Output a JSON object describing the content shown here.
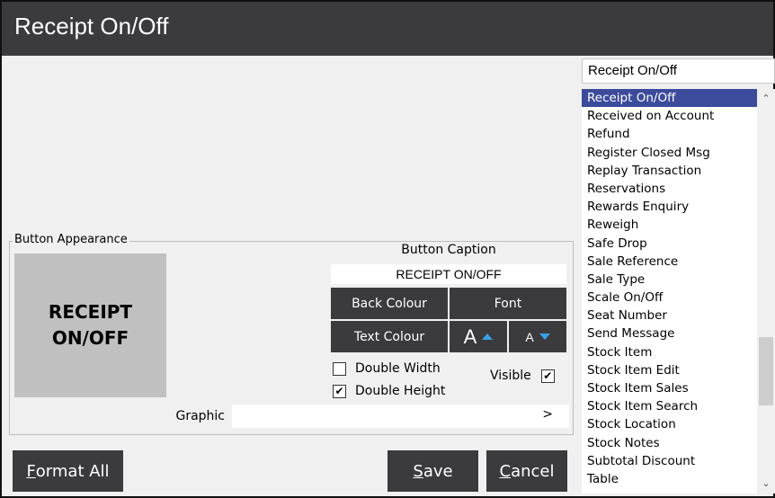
{
  "window": {
    "title": "Receipt On/Off"
  },
  "function_search": {
    "value": "Receipt On/Off"
  },
  "function_list": {
    "items": [
      "Receipt On/Off",
      "Received on Account",
      "Refund",
      "Register Closed Msg",
      "Replay Transaction",
      "Reservations",
      "Rewards Enquiry",
      "Reweigh",
      "Safe Drop",
      "Sale Reference",
      "Sale Type",
      "Scale On/Off",
      "Seat Number",
      "Send Message",
      "Stock Item",
      "Stock Item Edit",
      "Stock Item Sales",
      "Stock Item Search",
      "Stock Location",
      "Stock Notes",
      "Subtotal Discount",
      "Table"
    ],
    "selected": "Receipt On/Off",
    "scroll_up_icon": "chevron-up-icon",
    "scroll_down_icon": "chevron-down-icon"
  },
  "appearance": {
    "legend": "Button Appearance",
    "preview_line1": "RECEIPT",
    "preview_line2": "ON/OFF",
    "preview_color": "#c0c0c0",
    "caption_label": "Button Caption",
    "caption_value": "RECEIPT ON/OFF",
    "back_colour": "Back Colour",
    "font": "Font",
    "text_colour": "Text Colour",
    "font_increase_glyph": "A",
    "font_decrease_glyph": "A",
    "double_width": {
      "label": "Double Width",
      "checked": false
    },
    "double_height": {
      "label": "Double Height",
      "checked": true
    },
    "visible": {
      "label": "Visible",
      "checked": true
    },
    "graphic_label": "Graphic",
    "graphic_value": "",
    "graphic_arrow": ">"
  },
  "buttons": {
    "format_all_first": "F",
    "format_all_rest": "ormat All",
    "save_first": "S",
    "save_rest": "ave",
    "cancel_first": "C",
    "cancel_rest": "ancel"
  },
  "colors": {
    "title_bar": "#3b3b3e",
    "button": "#3b3b3e",
    "selection": "#3c4b9b",
    "accent_arrow": "#3aa0e8"
  }
}
